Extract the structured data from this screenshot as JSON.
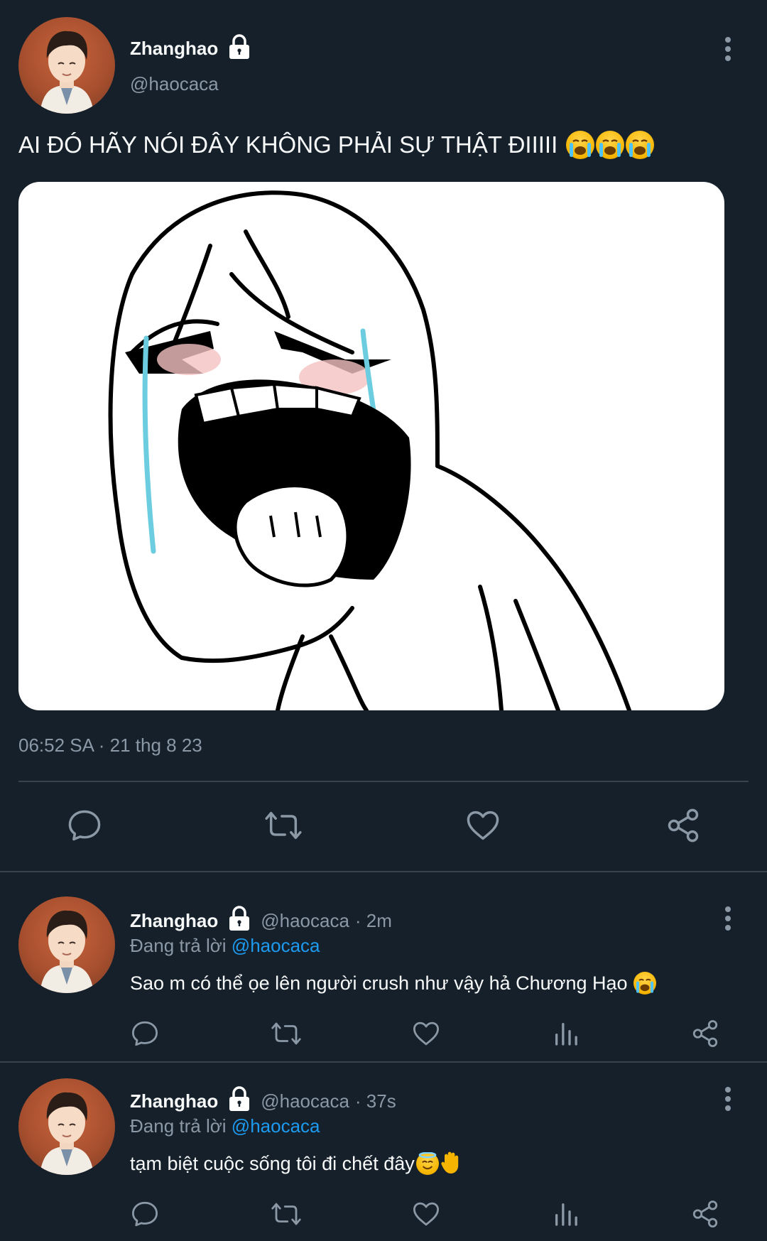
{
  "main_tweet": {
    "display_name": "Zhanghao",
    "handle": "@haocaca",
    "text": "AI ĐÓ HÃY NÓI ĐÂY KHÔNG PHẢI SỰ THẬT ĐIIIII",
    "timestamp": "06:52 SA · 21 thg 8 23",
    "media_icon": "crying-rage-face-meme",
    "actions": [
      "reply-icon",
      "retweet-icon",
      "like-icon",
      "share-icon"
    ]
  },
  "replies": [
    {
      "display_name": "Zhanghao",
      "handle": "@haocaca",
      "time": "· 2m",
      "replying_label": "Đang trả lời",
      "replying_to": "@haocaca",
      "text": "Sao m có thể ọe lên người crush như vậy hả Chương Hạo",
      "actions": [
        "reply-icon",
        "retweet-icon",
        "like-icon",
        "analytics-icon",
        "share-icon"
      ]
    },
    {
      "display_name": "Zhanghao",
      "handle": "@haocaca",
      "time": "· 37s",
      "replying_label": "Đang trả lời",
      "replying_to": "@haocaca",
      "text": "tạm biệt cuộc sống tôi đi chết đây",
      "actions": [
        "reply-icon",
        "retweet-icon",
        "like-icon",
        "analytics-icon",
        "share-icon"
      ]
    }
  ],
  "colors": {
    "background": "#15202b",
    "text": "#f7f9f9",
    "muted": "#8b98a5",
    "link": "#1d9bf0",
    "divider": "#38444d"
  }
}
